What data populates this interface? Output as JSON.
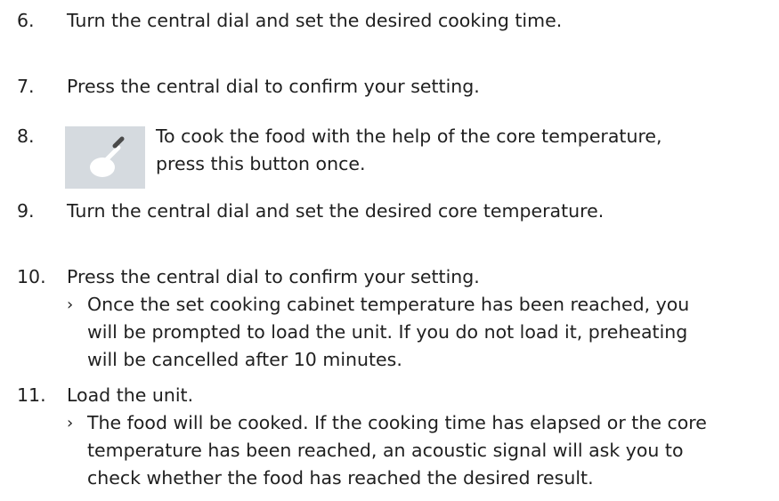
{
  "steps": [
    {
      "number": "6.",
      "text": "Turn the central dial and set the desired cooking time."
    },
    {
      "number": "7.",
      "text": "Press the central dial to confirm your setting."
    },
    {
      "number": "8.",
      "icon": "core-temperature-probe-icon",
      "lines": [
        "To cook the food with the help of the core temperature,",
        "press this button once."
      ]
    },
    {
      "number": "9.",
      "text": "Turn the central dial and set the desired core temperature."
    },
    {
      "number": "10.",
      "text": "Press the central dial to confirm your setting.",
      "result_marker": "›",
      "result_lines": [
        "Once the set cooking cabinet temperature has been reached, you",
        "will be prompted to load the unit. If you do not load it, preheating",
        "will be cancelled after 10 minutes."
      ]
    },
    {
      "number": "11.",
      "text": "Load the unit.",
      "result_marker": "›",
      "result_lines": [
        "The food will be cooked. If the cooking time has elapsed or the core",
        "temperature has been reached, an acoustic signal will ask you to",
        "check whether the food has reached the desired result."
      ]
    }
  ],
  "colors": {
    "text": "#1f1f1f",
    "icon_background": "#d5dadf",
    "icon_foreground": "#ffffff",
    "icon_probe": "#4a4a4a"
  }
}
